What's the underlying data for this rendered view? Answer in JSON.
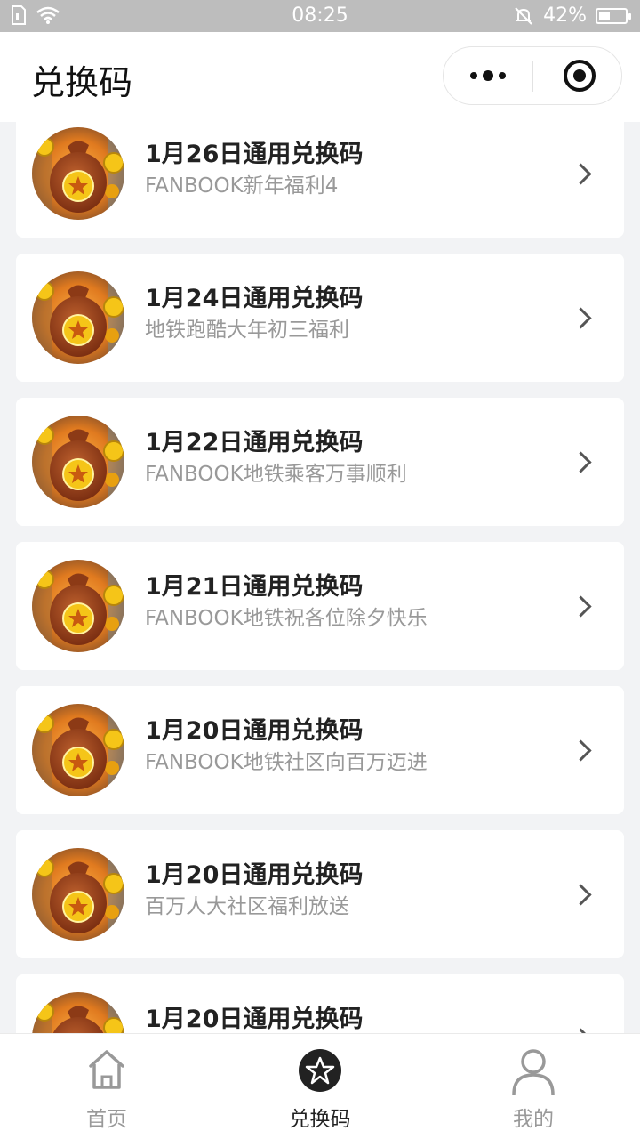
{
  "status_bar": {
    "time": "08:25",
    "battery": "42%",
    "battery_level": 0.42
  },
  "nav": {
    "title": "兑换码"
  },
  "list": [
    {
      "title": "1月26日通用兑换码",
      "subtitle": "FANBOOK新年福利4"
    },
    {
      "title": "1月24日通用兑换码",
      "subtitle": "地铁跑酷大年初三福利"
    },
    {
      "title": "1月22日通用兑换码",
      "subtitle": "FANBOOK地铁乘客万事顺利"
    },
    {
      "title": "1月21日通用兑换码",
      "subtitle": "FANBOOK地铁祝各位除夕快乐"
    },
    {
      "title": "1月20日通用兑换码",
      "subtitle": "FANBOOK地铁社区向百万迈进"
    },
    {
      "title": "1月20日通用兑换码",
      "subtitle": "百万人大社区福利放送"
    },
    {
      "title": "1月20日通用兑换码",
      "subtitle": ""
    }
  ],
  "tabbar": {
    "tabs": [
      {
        "label": "首页",
        "icon": "home-icon"
      },
      {
        "label": "兑换码",
        "icon": "star-icon"
      },
      {
        "label": "我的",
        "icon": "user-icon"
      }
    ],
    "active_index": 1
  }
}
